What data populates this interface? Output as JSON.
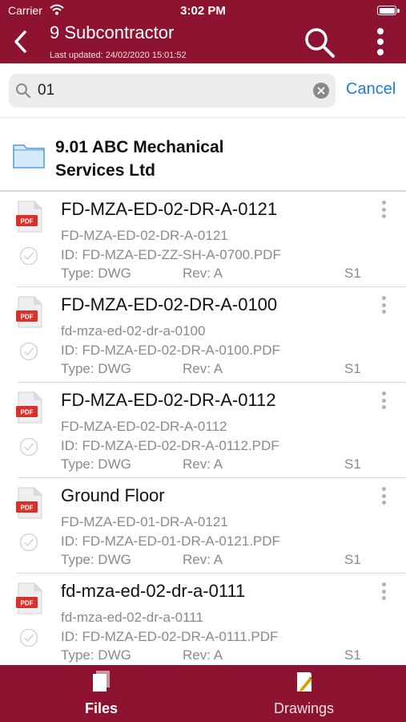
{
  "status_bar": {
    "carrier": "Carrier",
    "time": "3:02 PM"
  },
  "header": {
    "title": "9 Subcontractor",
    "subtitle": "Last updated: 24/02/2020 15:01:52",
    "back_icon": "chevron-left-icon",
    "search_icon": "search-icon",
    "more_icon": "more-vertical-icon"
  },
  "search": {
    "value": "01",
    "cancel_label": "Cancel"
  },
  "folder": {
    "name": "9.01 ABC Mechanical Services Ltd",
    "icon": "folder-icon"
  },
  "files": [
    {
      "title": "FD-MZA-ED-02-DR-A-0121",
      "subtitle": "FD-MZA-ED-02-DR-A-0121",
      "id": "ID: FD-MZA-ED-ZZ-SH-A-0700.PDF",
      "type": "Type: DWG",
      "rev": "Rev: A",
      "status": "S1"
    },
    {
      "title": "FD-MZA-ED-02-DR-A-0100",
      "subtitle": "fd-mza-ed-02-dr-a-0100",
      "id": "ID: FD-MZA-ED-02-DR-A-0100.PDF",
      "type": "Type: DWG",
      "rev": "Rev: A",
      "status": "S1"
    },
    {
      "title": "FD-MZA-ED-02-DR-A-0112",
      "subtitle": "FD-MZA-ED-02-DR-A-0112",
      "id": "ID: FD-MZA-ED-02-DR-A-0112.PDF",
      "type": "Type: DWG",
      "rev": "Rev: A",
      "status": "S1"
    },
    {
      "title": "Ground Floor",
      "subtitle": "FD-MZA-ED-01-DR-A-0121",
      "id": "ID: FD-MZA-ED-01-DR-A-0121.PDF",
      "type": "Type: DWG",
      "rev": "Rev: A",
      "status": "S1"
    },
    {
      "title": "fd-mza-ed-02-dr-a-0111",
      "subtitle": "fd-mza-ed-02-dr-a-0111",
      "id": "ID: FD-MZA-ED-02-DR-A-0111.PDF",
      "type": "Type: DWG",
      "rev": "Rev: A",
      "status": "S1"
    }
  ],
  "file_icon_label": "PDF",
  "tabs": [
    {
      "label": "Files",
      "icon": "files-icon",
      "active": true
    },
    {
      "label": "Drawings",
      "icon": "drawings-icon",
      "active": false
    }
  ],
  "colors": {
    "brand": "#8e1330",
    "link": "#1a7fd4",
    "pdf_red": "#d8312a",
    "folder_blue": "#d6e9f8"
  }
}
